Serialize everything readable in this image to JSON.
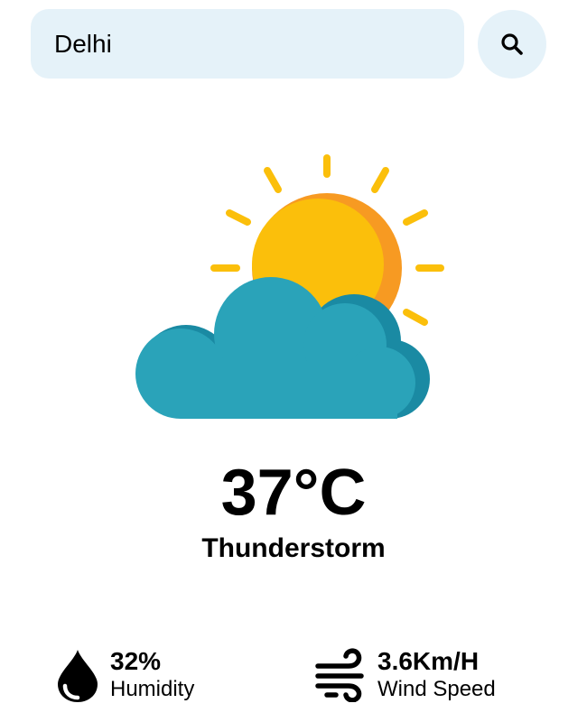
{
  "search": {
    "value": "Delhi"
  },
  "weather": {
    "icon": "partly-cloudy-sun-icon",
    "temperature": "37°C",
    "condition": "Thunderstorm"
  },
  "stats": {
    "humidity": {
      "icon": "water-drop-icon",
      "value": "32%",
      "label": "Humidity"
    },
    "wind": {
      "icon": "wind-icon",
      "value": "3.6Km/H",
      "label": "Wind Speed"
    }
  },
  "colors": {
    "search_bg": "#e5f2f9",
    "sun": "#fbbf0b",
    "sun_shadow": "#f79a22",
    "cloud": "#2aa3b9",
    "cloud_shadow": "#1a8aa3",
    "text": "#000000"
  }
}
